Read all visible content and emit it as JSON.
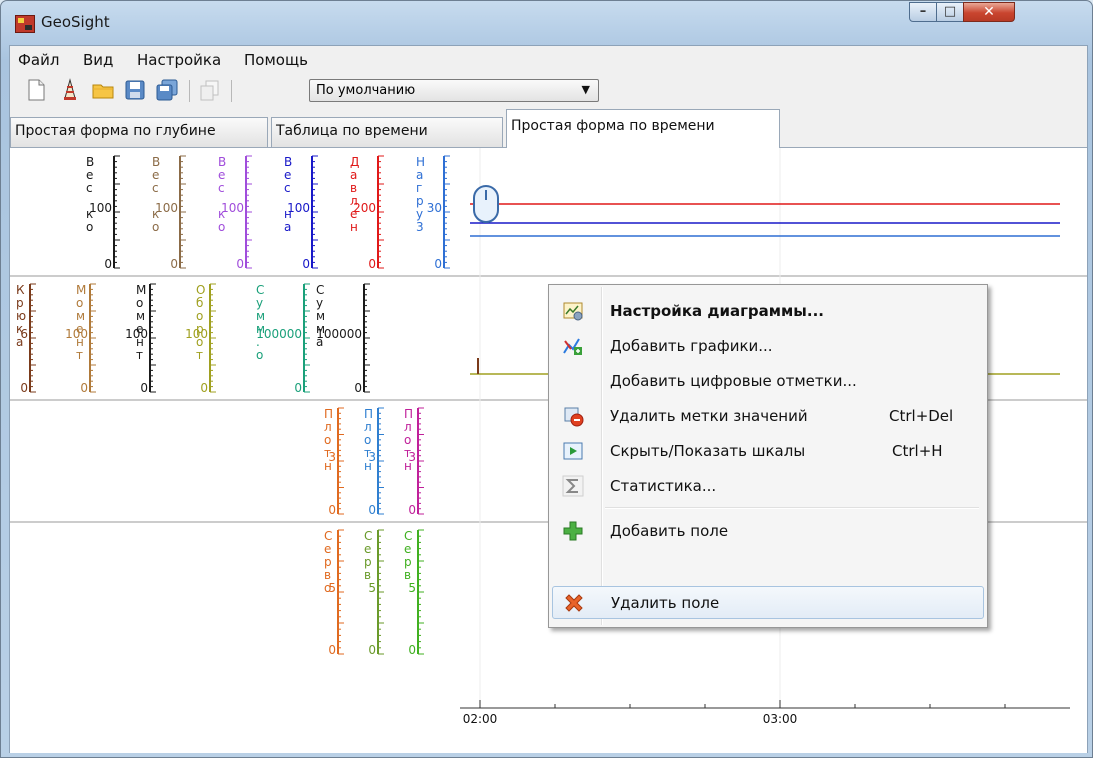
{
  "window": {
    "title": "GeoSight"
  },
  "menubar": {
    "items": [
      {
        "label": "Файл"
      },
      {
        "label": "Вид"
      },
      {
        "label": "Настройка"
      },
      {
        "label": "Помощь"
      }
    ]
  },
  "toolbar": {
    "preset_value": "По умолчанию"
  },
  "tabs": [
    {
      "label": "Простая форма по глубине"
    },
    {
      "label": "Таблица по времени"
    },
    {
      "label": "Простая форма по времени"
    }
  ],
  "time_axis": {
    "ticks": [
      "02:00",
      "03:00"
    ]
  },
  "tracks": [
    {
      "scales": [
        {
          "name": "Вес ко",
          "max": 100,
          "min": 0,
          "color": "#1a1a1a"
        },
        {
          "name": "Вес ко",
          "max": 100,
          "min": 0,
          "color": "#8b6b47"
        },
        {
          "name": "Вес ко",
          "max": 100,
          "min": 0,
          "color": "#a04ddb"
        },
        {
          "name": "Вес на",
          "max": 100,
          "min": 0,
          "color": "#1818c8"
        },
        {
          "name": "Давлен",
          "max": 200,
          "min": 0,
          "color": "#e01818"
        },
        {
          "name": "Нагру3",
          "max": 30,
          "min": 0,
          "color": "#2e6fd4"
        }
      ]
    },
    {
      "scales": [
        {
          "name": "Крюка",
          "max": 6,
          "min": 0,
          "color": "#7a3a1a"
        },
        {
          "name": "Момент",
          "max": 100,
          "min": 0,
          "color": "#b07a3a"
        },
        {
          "name": "Момент",
          "max": 100,
          "min": 0,
          "color": "#1a1a1a"
        },
        {
          "name": "Оборот",
          "max": 100,
          "min": 0,
          "color": "#a0a020"
        },
        {
          "name": "Сумм.о",
          "max": 100000,
          "min": 0,
          "color": "#1aa07a"
        },
        {
          "name": "Сумма",
          "max": 100000,
          "min": 0,
          "color": "#1a1a1a"
        }
      ]
    },
    {
      "scales": [
        {
          "name": "Плотн",
          "max": 3,
          "min": 0,
          "color": "#e06a20"
        },
        {
          "name": "Плотн",
          "max": 3,
          "min": 0,
          "color": "#2f7fd0"
        },
        {
          "name": "Плотн",
          "max": 3,
          "min": 0,
          "color": "#c0209a"
        }
      ]
    },
    {
      "scales": [
        {
          "name": "Серво",
          "max": 5,
          "min": 0,
          "color": "#e06a20"
        },
        {
          "name": "Серв",
          "max": 5,
          "min": 0,
          "color": "#6a9a2a"
        },
        {
          "name": "Серв",
          "max": 5,
          "min": 0,
          "color": "#40b020"
        }
      ]
    }
  ],
  "context_menu": {
    "items": [
      {
        "label": "Настройка диаграммы...",
        "shortcut": "",
        "bold": true
      },
      {
        "label": "Добавить графики...",
        "shortcut": ""
      },
      {
        "label": "Добавить цифровые отметки...",
        "shortcut": ""
      },
      {
        "label": "Удалить метки значений",
        "shortcut": "Ctrl+Del"
      },
      {
        "label": "Скрыть/Показать шкалы",
        "shortcut": "Ctrl+H"
      },
      {
        "label": "Статистика...",
        "shortcut": ""
      },
      {
        "label": "Добавить поле",
        "shortcut": ""
      },
      {
        "label": "Удалить поле",
        "shortcut": ""
      }
    ]
  }
}
